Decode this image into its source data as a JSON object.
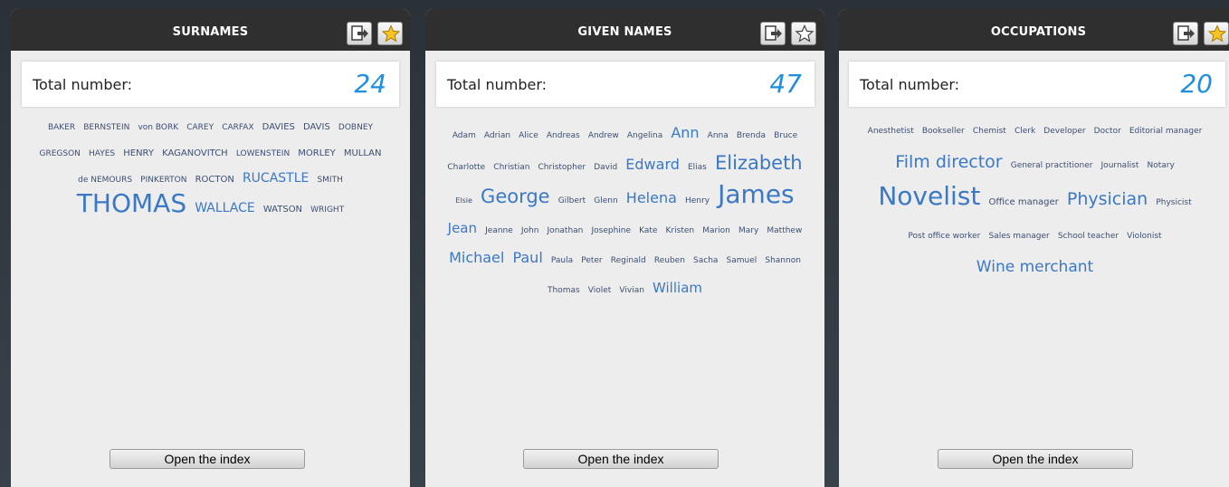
{
  "panels": [
    {
      "title": "SURNAMES",
      "total_label": "Total number:",
      "total_value": "24",
      "open_label": "Open the index",
      "words": [
        [
          "BAKER",
          9
        ],
        [
          "BERNSTEIN",
          9
        ],
        [
          "von BORK",
          9
        ],
        [
          "CAREY",
          9
        ],
        [
          "CARFAX",
          9
        ],
        [
          "DAVIES",
          10
        ],
        [
          "DAVIS",
          10
        ],
        [
          "DOBNEY",
          9
        ],
        [
          "GREGSON",
          9
        ],
        [
          "HAYES",
          9
        ],
        [
          "HENRY",
          10
        ],
        [
          "KAGANOVITCH",
          10
        ],
        [
          "LOWENSTEIN",
          9
        ],
        [
          "MORLEY",
          10
        ],
        [
          "MULLAN",
          10
        ],
        [
          "de NEMOURS",
          9
        ],
        [
          "PINKERTON",
          9
        ],
        [
          "ROCTON",
          10
        ],
        [
          "RUCASTLE",
          14
        ],
        [
          "SMITH",
          9
        ],
        [
          "THOMAS",
          28
        ],
        [
          "WALLACE",
          14
        ],
        [
          "WATSON",
          10
        ],
        [
          "WRIGHT",
          9
        ]
      ]
    },
    {
      "title": "GIVEN NAMES",
      "total_label": "Total number:",
      "total_value": "47",
      "open_label": "Open the index",
      "words": [
        [
          "Adam",
          9
        ],
        [
          "Adrian",
          9
        ],
        [
          "Alice",
          9
        ],
        [
          "Andreas",
          9
        ],
        [
          "Andrew",
          9
        ],
        [
          "Angelina",
          9
        ],
        [
          "Ann",
          16
        ],
        [
          "Anna",
          9
        ],
        [
          "Brenda",
          9
        ],
        [
          "Bruce",
          9
        ],
        [
          "Charlotte",
          9
        ],
        [
          "Christian",
          9
        ],
        [
          "Christopher",
          9
        ],
        [
          "David",
          9
        ],
        [
          "Edward",
          16
        ],
        [
          "Elias",
          9
        ],
        [
          "Elizabeth",
          21
        ],
        [
          "Elsie",
          8
        ],
        [
          "George",
          21
        ],
        [
          "Gilbert",
          9
        ],
        [
          "Glenn",
          9
        ],
        [
          "Helena",
          16
        ],
        [
          "Henry",
          9
        ],
        [
          "James",
          28
        ],
        [
          "Jean",
          15
        ],
        [
          "Jeanne",
          9
        ],
        [
          "John",
          9
        ],
        [
          "Jonathan",
          9
        ],
        [
          "Josephine",
          9
        ],
        [
          "Kate",
          9
        ],
        [
          "Kristen",
          9
        ],
        [
          "Marion",
          9
        ],
        [
          "Mary",
          9
        ],
        [
          "Matthew",
          9
        ],
        [
          "Michael",
          16
        ],
        [
          "Paul",
          16
        ],
        [
          "Paula",
          9
        ],
        [
          "Peter",
          9
        ],
        [
          "Reginald",
          9
        ],
        [
          "Reuben",
          9
        ],
        [
          "Sacha",
          9
        ],
        [
          "Samuel",
          9
        ],
        [
          "Shannon",
          9
        ],
        [
          "Thomas",
          9
        ],
        [
          "Violet",
          9
        ],
        [
          "Vivian",
          9
        ],
        [
          "William",
          15
        ]
      ]
    },
    {
      "title": "OCCUPATIONS",
      "total_label": "Total number:",
      "total_value": "20",
      "open_label": "Open the index",
      "words": [
        [
          "Anesthetist",
          9
        ],
        [
          "Bookseller",
          9
        ],
        [
          "Chemist",
          9
        ],
        [
          "Clerk",
          9
        ],
        [
          "Developer",
          9
        ],
        [
          "Doctor",
          9
        ],
        [
          "Editorial manager",
          9
        ],
        [
          "Film director",
          19
        ],
        [
          "General practitioner",
          9
        ],
        [
          "Journalist",
          9
        ],
        [
          "Notary",
          9
        ],
        [
          "Novelist",
          28
        ],
        [
          "Office manager",
          10
        ],
        [
          "Physician",
          19
        ],
        [
          "Physicist",
          9
        ],
        [
          "Post office worker",
          9
        ],
        [
          "Sales manager",
          9
        ],
        [
          "School teacher",
          9
        ],
        [
          "Violonist",
          9
        ],
        [
          "Wine merchant",
          17
        ]
      ]
    }
  ],
  "icons": {
    "export": "export-icon",
    "favorite": "star-icon"
  },
  "colors": {
    "header_bg": "#2f2f2f",
    "panel_bg": "#ededed",
    "total_value": "#1e8fe0",
    "cloud_small": "#3c4f73",
    "cloud_large": "#3b78c5"
  }
}
